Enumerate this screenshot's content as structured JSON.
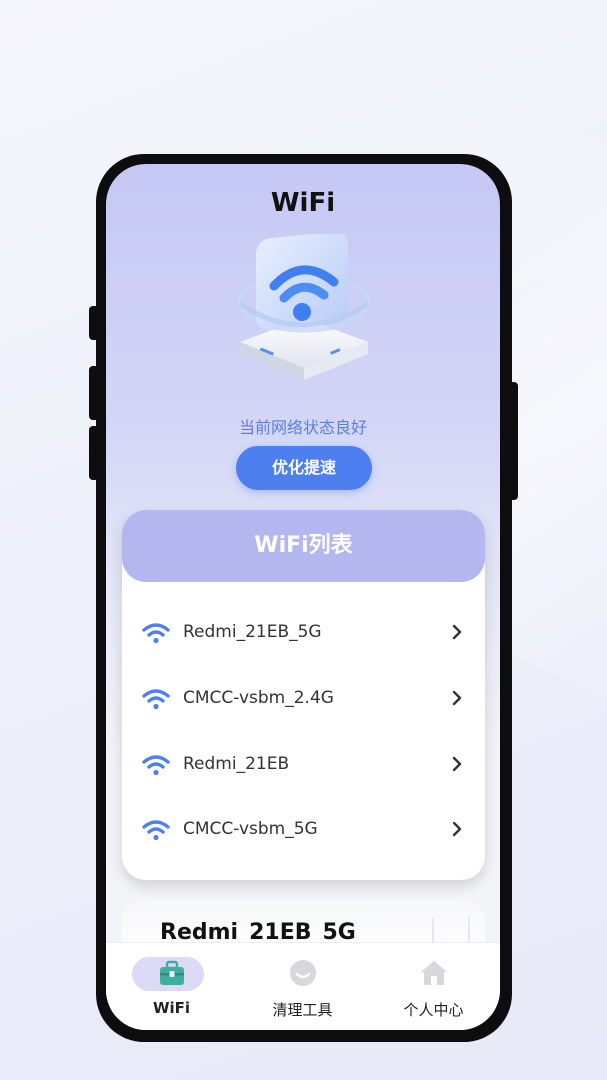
{
  "page": {
    "title": "WiFi",
    "status_text": "当前网络状态良好",
    "optimize_button": "优化提速"
  },
  "wifi_list": {
    "header": "WiFi列表",
    "networks": [
      {
        "name": "Redmi_21EB_5G"
      },
      {
        "name": "CMCC-vsbm_2.4G"
      },
      {
        "name": "Redmi_21EB"
      },
      {
        "name": "CMCC-vsbm_5G"
      }
    ]
  },
  "current_network": {
    "name": "Redmi_21EB_5G"
  },
  "tabbar": {
    "tabs": [
      {
        "label": "WiFi",
        "icon": "toolbox-icon",
        "active": true
      },
      {
        "label": "清理工具",
        "icon": "smile-icon",
        "active": false
      },
      {
        "label": "个人中心",
        "icon": "home-icon",
        "active": false
      }
    ]
  },
  "colors": {
    "accent": "#4d7ff0",
    "wifi_icon": "#4d7ff0",
    "list_header": "#b4b7ef",
    "tab_active_pill": "#dcdaf6",
    "tab_active_icon": "#3fae9f",
    "tab_inactive_icon": "#d7d7dd"
  }
}
